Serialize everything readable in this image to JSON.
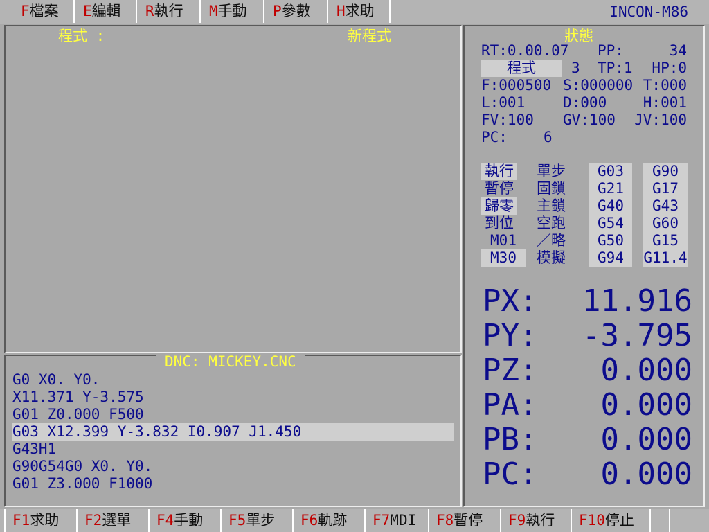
{
  "menu": [
    {
      "key": "F",
      "label": "檔案"
    },
    {
      "key": "E",
      "label": "編輯"
    },
    {
      "key": "R",
      "label": "執行"
    },
    {
      "key": "M",
      "label": "手動"
    },
    {
      "key": "P",
      "label": "參數"
    },
    {
      "key": "H",
      "label": "求助"
    }
  ],
  "app_title": "INCON-M86",
  "program_panel": {
    "label": "程式 :",
    "name": "新程式"
  },
  "dnc": {
    "title": "DNC: MICKEY.CNC",
    "lines": [
      "G0 X0. Y0.",
      "X11.371 Y-3.575",
      "G01 Z0.000 F500",
      "G03 X12.399 Y-3.832 I0.907 J1.450",
      "G43H1",
      "G90G54G0 X0. Y0.",
      "G01 Z3.000 F1000"
    ],
    "highlighted_index": 3
  },
  "status": {
    "title": "狀態",
    "rt": "RT:0.00.07",
    "pp_label": "PP:",
    "pp_value": "34",
    "mode": "程式",
    "mode_num": "3",
    "tp": "TP:1",
    "hp": "HP:0",
    "f": "F:000500",
    "s": "S:000000",
    "t": "T:000",
    "l": "L:001",
    "d": "D:000",
    "h": "H:001",
    "fv": "FV:100",
    "gv": "GV:100",
    "jv": "JV:100",
    "pc_label": "PC:",
    "pc_value": "6",
    "flags_col1": [
      "執行",
      "暫停",
      "歸零",
      "到位",
      "M01",
      "M30"
    ],
    "flags_col1_active": [
      true,
      false,
      true,
      false,
      false,
      true
    ],
    "flags_col2": [
      "單步",
      "固鎖",
      "主鎖",
      "空跑",
      "／略",
      "模擬"
    ],
    "gcodes_col1": [
      "G03",
      "G21",
      "G40",
      "G54",
      "G50",
      "G94"
    ],
    "gcodes_col2": [
      "G90",
      "G17",
      "G43",
      "G60",
      "G15",
      "G11.4"
    ]
  },
  "axes": [
    {
      "label": "PX:",
      "value": "11.916"
    },
    {
      "label": "PY:",
      "value": "-3.795"
    },
    {
      "label": "PZ:",
      "value": "0.000"
    },
    {
      "label": "PA:",
      "value": "0.000"
    },
    {
      "label": "PB:",
      "value": "0.000"
    },
    {
      "label": "PC:",
      "value": "0.000"
    }
  ],
  "fkeys": [
    {
      "fn": "F1",
      "label": "求助"
    },
    {
      "fn": "F2",
      "label": "選單"
    },
    {
      "fn": "F4",
      "label": "手動"
    },
    {
      "fn": "F5",
      "label": "單步"
    },
    {
      "fn": "F6",
      "label": "軌跡"
    },
    {
      "fn": "F7",
      "label": "MDI"
    },
    {
      "fn": "F8",
      "label": "暫停"
    },
    {
      "fn": "F9",
      "label": "執行"
    },
    {
      "fn": "F10",
      "label": "停止"
    }
  ]
}
